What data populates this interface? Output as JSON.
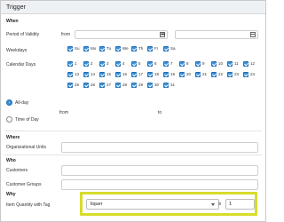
{
  "panel": {
    "title": "Trigger"
  },
  "sections": {
    "when": "When",
    "where": "Where",
    "who": "Who",
    "why": "Why"
  },
  "period": {
    "label": "Period of Validity",
    "from_label": "from",
    "to_label": "to"
  },
  "weekdays": {
    "label": "Weekdays",
    "items": [
      "Su",
      "Mo",
      "Tu",
      "We",
      "Th",
      "Fr",
      "Sa"
    ]
  },
  "calendar_days": {
    "label": "Calendar Days",
    "rows": [
      [
        "1",
        "2",
        "3",
        "4",
        "5",
        "6",
        "7",
        "8",
        "9",
        "10",
        "11",
        "12"
      ],
      [
        "13",
        "14",
        "15",
        "16",
        "17",
        "18",
        "19",
        "20",
        "21",
        "22",
        "23",
        "24"
      ],
      [
        "25",
        "26",
        "27",
        "28",
        "29",
        "30",
        "31"
      ]
    ]
  },
  "time": {
    "all_day_label": "All-day",
    "time_of_day_label": "Time of Day",
    "from_label": "from",
    "to_label": "to",
    "selected": "All-day"
  },
  "where": {
    "org_units_label": "Organizational Units"
  },
  "who": {
    "customers_label": "Customers",
    "customer_groups_label": "Customer Groups"
  },
  "why": {
    "label": "Item Quantity with Tag",
    "tag_value": "liquer",
    "operator": "≥",
    "quantity": "1"
  },
  "colors": {
    "highlight": "#d8dc2a",
    "checkbox": "#3b8fd9"
  }
}
